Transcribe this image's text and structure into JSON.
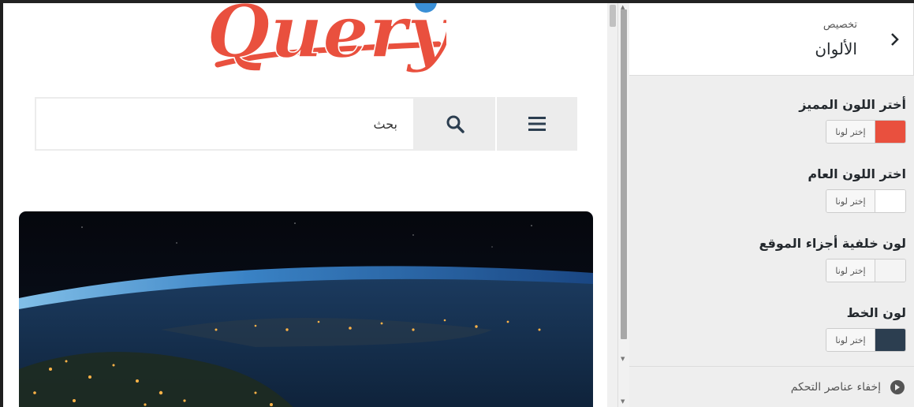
{
  "preview": {
    "logo_text": "Query",
    "search_placeholder": "بحث"
  },
  "panel": {
    "subtitle": "تخصيص",
    "title": "الألوان",
    "pick_label": "إختر لونا",
    "sections": [
      {
        "label": "أختر اللون المميز",
        "color": "#e9503e"
      },
      {
        "label": "اختر اللون العام",
        "color": "#ffffff"
      },
      {
        "label": "لون خلفية أجزاء الموقع",
        "color": "#f4f4f4"
      },
      {
        "label": "لون الخط",
        "color": "#2c3e50"
      }
    ],
    "hide_controls": "إخفاء عناصر التحكم"
  },
  "icons": {
    "back": "chevron-right-icon",
    "menu": "hamburger-icon",
    "search": "search-icon",
    "hide": "play-circle-icon"
  }
}
